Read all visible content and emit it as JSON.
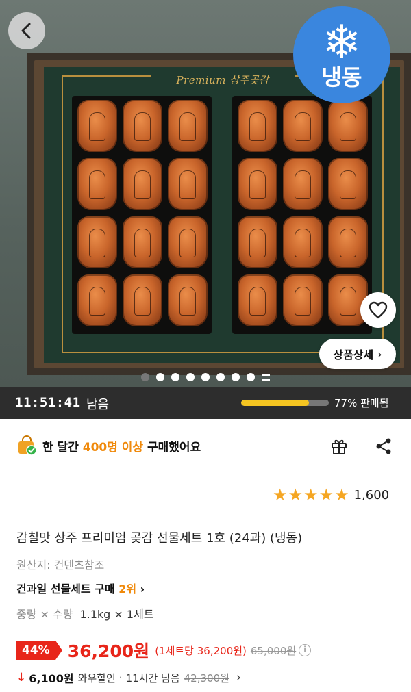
{
  "hero": {
    "brand_text": "Premium 상주곶감",
    "badge_text": "냉동",
    "detail_button_label": "상품상세",
    "carousel": {
      "total_dots": 8,
      "active_index": 0
    }
  },
  "timer": {
    "time_remaining": "11:51:41",
    "remaining_label": "남음",
    "sold_percent": 77,
    "sold_text": "77% 판매됨"
  },
  "social_proof": {
    "prefix": "한 달간 ",
    "highlight": "400명 이상",
    "suffix": " 구매했어요"
  },
  "rating": {
    "stars": 5,
    "review_count": "1,600"
  },
  "product": {
    "title": "감칠맛 상주 프리미엄 곶감 선물세트 1호 (24과) (냉동)",
    "origin": "원산지: 컨텐츠참조",
    "rank_prefix": "건과일 선물세트 구매 ",
    "rank_value": "2위",
    "option_label": "중량 × 수량",
    "option_value": "1.1kg × 1세트"
  },
  "price": {
    "discount": "44%",
    "sale_price": "36,200원",
    "unit_price": "(1세트당 36,200원)",
    "original_price": "65,000원"
  },
  "wow": {
    "amount": "6,100원",
    "label": "와우할인",
    "separator": "·",
    "time_left": "11시간 남음",
    "original_price": "42,300원"
  },
  "colors": {
    "accent_orange": "#f08a0c",
    "sale_red": "#e8261a",
    "badge_blue": "#3a86de",
    "progress_yellow": "#f5c521",
    "star_orange": "#f5a623"
  }
}
